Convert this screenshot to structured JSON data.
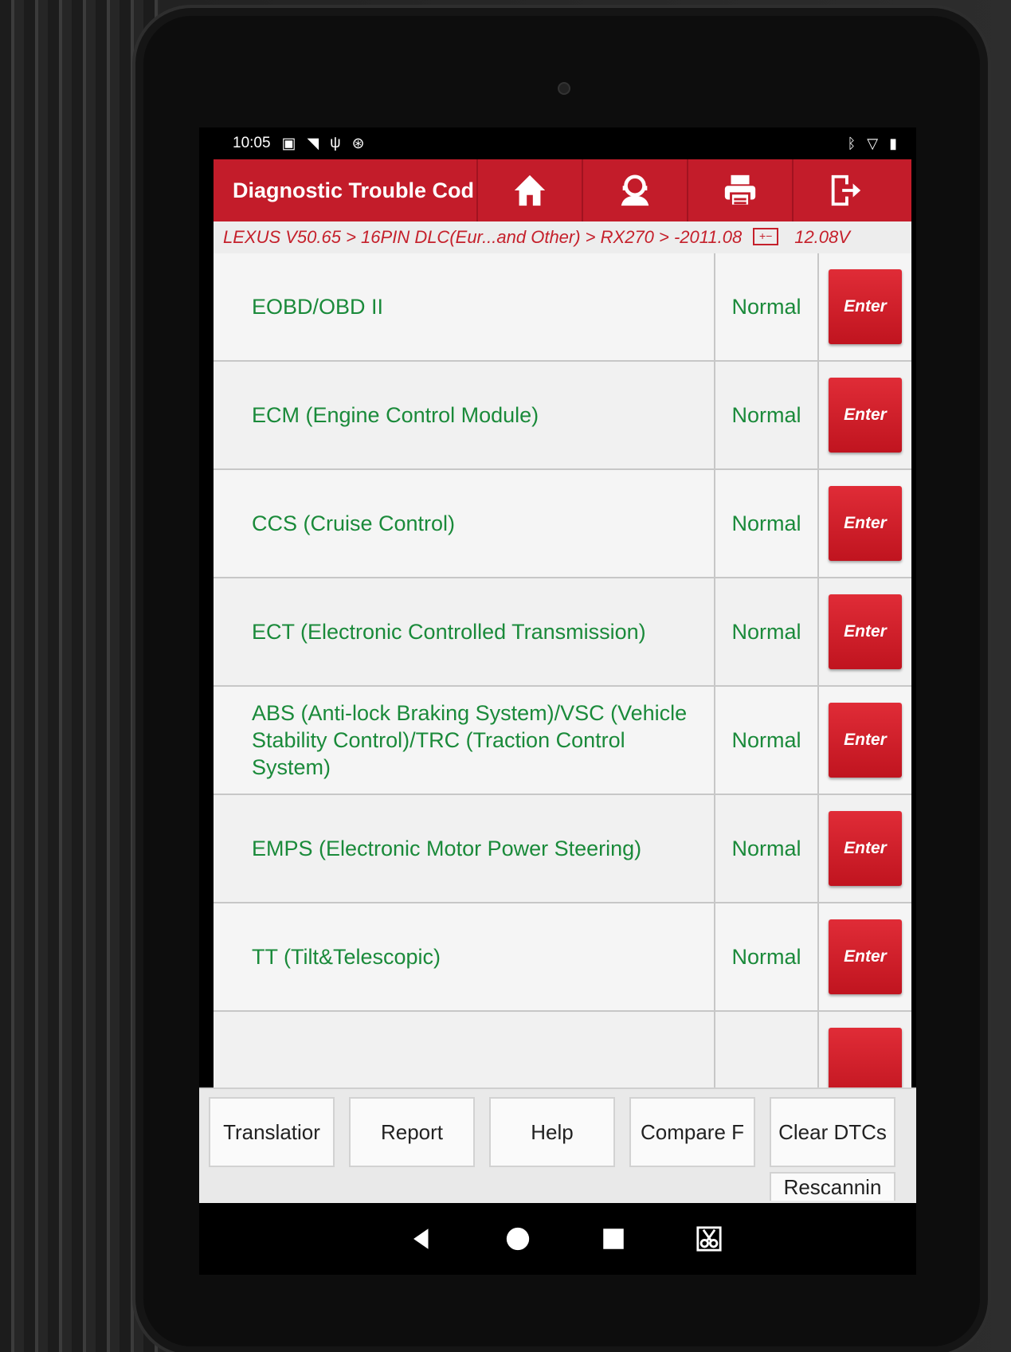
{
  "status_bar": {
    "time": "10:05"
  },
  "header": {
    "title": "Diagnostic Trouble Cod"
  },
  "toolbar": {
    "icons": [
      "home-icon",
      "user-support-icon",
      "printer-icon",
      "exit-icon"
    ]
  },
  "breadcrumb": {
    "path": "LEXUS V50.65 > 16PIN DLC(Eur...and Other) > RX270 > -2011.08",
    "battery_icon": "battery-icon",
    "voltage": "12.08V"
  },
  "systems": [
    {
      "name": "EOBD/OBD II",
      "status": "Normal",
      "action": "Enter"
    },
    {
      "name": "ECM (Engine Control Module)",
      "status": "Normal",
      "action": "Enter"
    },
    {
      "name": "CCS (Cruise Control)",
      "status": "Normal",
      "action": "Enter"
    },
    {
      "name": "ECT (Electronic Controlled Transmission)",
      "status": "Normal",
      "action": "Enter"
    },
    {
      "name": "ABS (Anti-lock Braking System)/VSC (Vehicle Stability Control)/TRC (Traction Control System)",
      "status": "Normal",
      "action": "Enter"
    },
    {
      "name": "EMPS (Electronic Motor Power Steering)",
      "status": "Normal",
      "action": "Enter"
    },
    {
      "name": "TT (Tilt&Telescopic)",
      "status": "Normal",
      "action": "Enter"
    }
  ],
  "bottom_buttons": {
    "translation": "Translatior",
    "report": "Report",
    "help": "Help",
    "compare": "Compare F",
    "clear_dtcs": "Clear DTCs",
    "rescanning": "Rescannin"
  },
  "colors": {
    "header_red": "#c31c2a",
    "system_green": "#1a8a3a",
    "enter_red": "#d0202b"
  }
}
